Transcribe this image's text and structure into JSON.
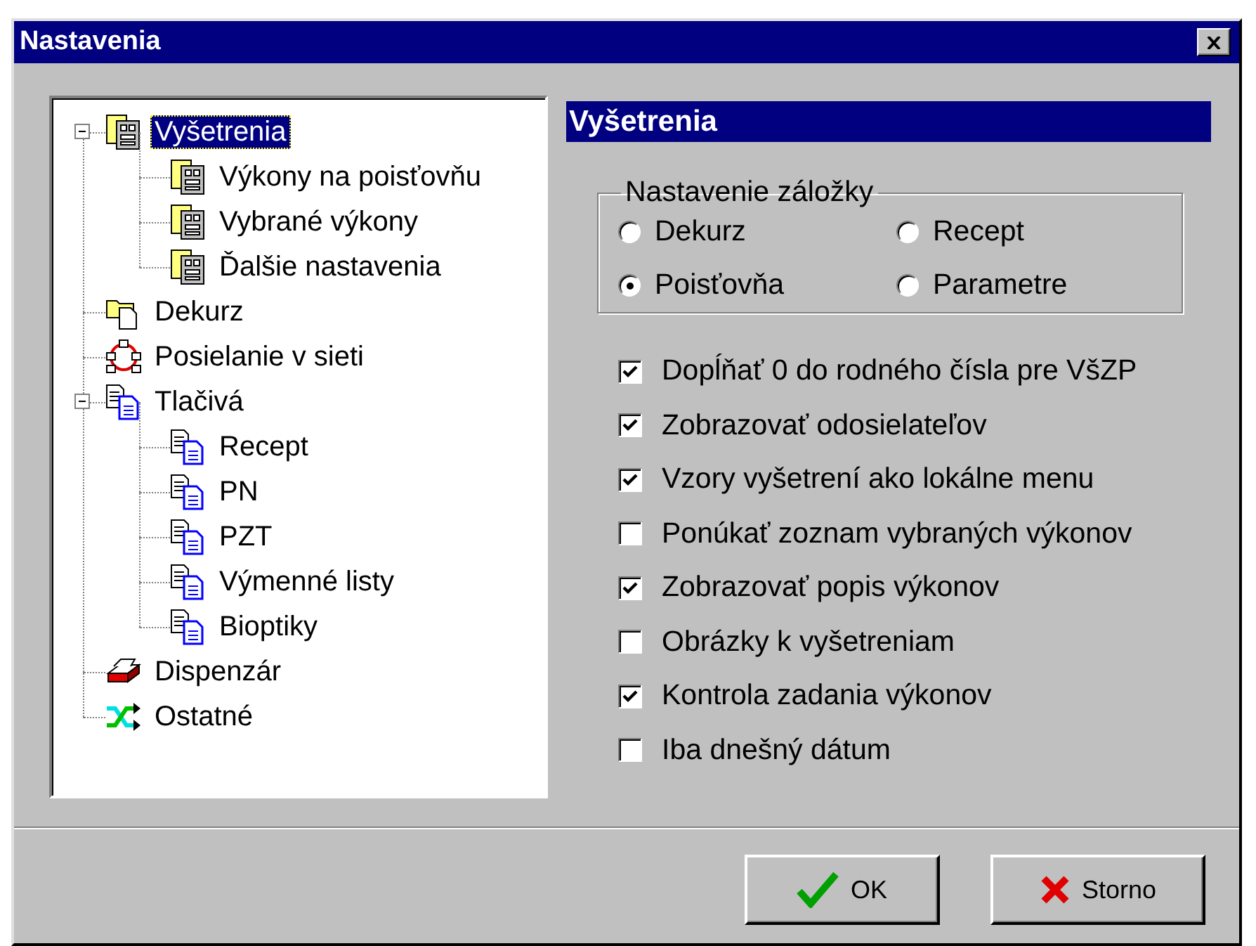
{
  "window": {
    "title": "Nastavenia"
  },
  "tree": [
    {
      "label": "Vyšetrenia",
      "kind": "form",
      "selected": true,
      "expanded": true,
      "children": [
        {
          "label": "Výkony na poisťovňu",
          "kind": "form",
          "selected": false
        },
        {
          "label": "Vybrané výkony",
          "kind": "form",
          "selected": false
        },
        {
          "label": "Ďalšie nastavenia",
          "kind": "form",
          "selected": false
        }
      ]
    },
    {
      "label": "Dekurz",
      "kind": "folder",
      "selected": false
    },
    {
      "label": "Posielanie v sieti",
      "kind": "network",
      "selected": false
    },
    {
      "label": "Tlačivá",
      "kind": "print",
      "selected": false,
      "expanded": true,
      "children": [
        {
          "label": "Recept",
          "kind": "print",
          "selected": false
        },
        {
          "label": "PN",
          "kind": "print",
          "selected": false
        },
        {
          "label": "PZT",
          "kind": "print",
          "selected": false
        },
        {
          "label": "Výmenné listy",
          "kind": "print",
          "selected": false
        },
        {
          "label": "Bioptiky",
          "kind": "print",
          "selected": false
        }
      ]
    },
    {
      "label": "Dispenzár",
      "kind": "drawer",
      "selected": false
    },
    {
      "label": "Ostatné",
      "kind": "shuffle",
      "selected": false
    }
  ],
  "panel": {
    "title": "Vyšetrenia",
    "group": {
      "title": "Nastavenie záložky",
      "options": [
        {
          "label": "Dekurz",
          "selected": false
        },
        {
          "label": "Recept",
          "selected": false
        },
        {
          "label": "Poisťovňa",
          "selected": true
        },
        {
          "label": "Parametre",
          "selected": false
        }
      ]
    },
    "checkboxes": [
      {
        "label": "Dopĺňať 0 do rodného čísla pre VšZP",
        "checked": true
      },
      {
        "label": "Zobrazovať odosielateľov",
        "checked": true
      },
      {
        "label": "Vzory vyšetrení ako lokálne menu",
        "checked": true
      },
      {
        "label": "Ponúkať zoznam vybraných výkonov",
        "checked": false
      },
      {
        "label": "Zobrazovať popis výkonov",
        "checked": true
      },
      {
        "label": "Obrázky k vyšetreniam",
        "checked": false
      },
      {
        "label": "Kontrola zadania výkonov",
        "checked": true
      },
      {
        "label": "Iba dnešný dátum",
        "checked": false
      }
    ]
  },
  "buttons": [
    {
      "label": "OK",
      "kind": "ok"
    },
    {
      "label": "Storno",
      "kind": "cancel"
    }
  ]
}
